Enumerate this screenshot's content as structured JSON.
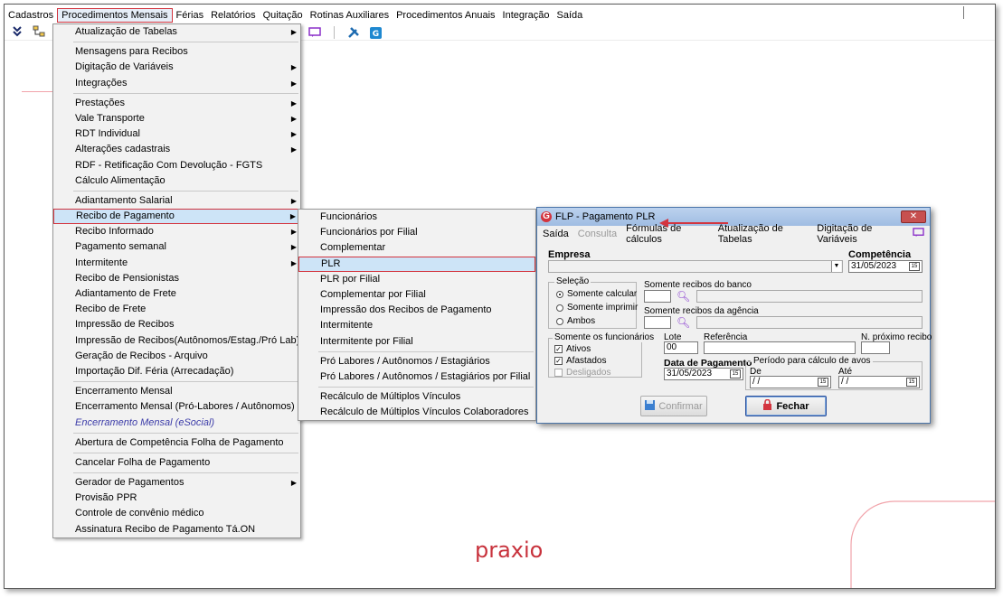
{
  "menubar": {
    "items": [
      "Cadastros",
      "Procedimentos Mensais",
      "Férias",
      "Relatórios",
      "Quitação",
      "Rotinas Auxiliares",
      "Procedimentos Anuais",
      "Integração",
      "Saída"
    ]
  },
  "main_menu": {
    "items": [
      {
        "label": "Atualização de Tabelas",
        "arrow": true
      },
      {
        "sep": true
      },
      {
        "label": "Mensagens para Recibos"
      },
      {
        "label": "Digitação de Variáveis",
        "arrow": true
      },
      {
        "label": "Integrações",
        "arrow": true
      },
      {
        "sep": true
      },
      {
        "label": "Prestações",
        "arrow": true
      },
      {
        "label": "Vale Transporte",
        "arrow": true
      },
      {
        "label": "RDT Individual",
        "arrow": true
      },
      {
        "label": "Alterações cadastrais",
        "arrow": true
      },
      {
        "label": "RDF - Retificação Com Devolução - FGTS"
      },
      {
        "label": "Cálculo Alimentação"
      },
      {
        "sep": true
      },
      {
        "label": "Adiantamento Salarial",
        "arrow": true
      },
      {
        "label": "Recibo de Pagamento",
        "arrow": true,
        "highlight": true
      },
      {
        "label": "Recibo Informado",
        "arrow": true
      },
      {
        "label": "Pagamento semanal",
        "arrow": true
      },
      {
        "label": "Intermitente",
        "arrow": true
      },
      {
        "label": "Recibo de Pensionistas"
      },
      {
        "label": "Adiantamento de Frete"
      },
      {
        "label": "Recibo de Frete"
      },
      {
        "label": "Impressão de Recibos"
      },
      {
        "label": "Impressão de Recibos(Autônomos/Estag./Pró Lab)"
      },
      {
        "label": "Geração de Recibos - Arquivo"
      },
      {
        "label": "Importação Dif. Féria (Arrecadação)"
      },
      {
        "sep": true
      },
      {
        "label": "Encerramento Mensal"
      },
      {
        "label": "Encerramento Mensal (Pró-Labores / Autônomos)"
      },
      {
        "label": "Encerramento Mensal (eSocial)",
        "blue": true
      },
      {
        "sep": true
      },
      {
        "label": "Abertura de Competência Folha de Pagamento"
      },
      {
        "sep": true
      },
      {
        "label": "Cancelar Folha de Pagamento"
      },
      {
        "sep": true
      },
      {
        "label": "Gerador de Pagamentos",
        "arrow": true
      },
      {
        "label": "Provisão PPR"
      },
      {
        "label": "Controle de convênio médico"
      },
      {
        "label": "Assinatura Recibo de Pagamento Tá.ON"
      }
    ]
  },
  "sub_menu": {
    "items": [
      {
        "label": "Funcionários"
      },
      {
        "label": "Funcionários por Filial"
      },
      {
        "label": "Complementar"
      },
      {
        "label": "PLR",
        "highlight": true
      },
      {
        "label": "PLR por Filial"
      },
      {
        "label": "Complementar por Filial"
      },
      {
        "label": "Impressão dos Recibos de Pagamento"
      },
      {
        "label": "Intermitente"
      },
      {
        "label": "Intermitente por Filial"
      },
      {
        "sep": true
      },
      {
        "label": "Pró Labores / Autônomos / Estagiários"
      },
      {
        "label": "Pró Labores / Autônomos / Estagiários por Filial"
      },
      {
        "sep": true
      },
      {
        "label": "Recálculo de Múltiplos Vínculos"
      },
      {
        "label": "Recálculo de Múltiplos Vínculos Colaboradores"
      }
    ]
  },
  "dialog": {
    "title": "FLP - Pagamento PLR",
    "menu": [
      {
        "label": "Saída",
        "disabled": false
      },
      {
        "label": "Consulta",
        "disabled": true
      },
      {
        "label": "Fórmulas de cálculos",
        "disabled": false
      },
      {
        "label": "Atualização de Tabelas",
        "disabled": false
      },
      {
        "label": "Digitação de Variáveis",
        "disabled": false
      }
    ],
    "empresa_label": "Empresa",
    "competencia_label": "Competência",
    "competencia_value": "31/05/2023",
    "selecao_label": "Seleção",
    "selecao_options": [
      "Somente calcular",
      "Somente imprimir",
      "Ambos"
    ],
    "banco_label": "Somente recibos do banco",
    "agencia_label": "Somente recibos da agência",
    "funcionarios_label": "Somente os funcionários",
    "funcionarios_options": [
      {
        "label": "Ativos",
        "checked": true,
        "disabled": false
      },
      {
        "label": "Afastados",
        "checked": true,
        "disabled": false
      },
      {
        "label": "Desligados",
        "checked": false,
        "disabled": true
      }
    ],
    "lote_label": "Lote",
    "lote_value": "00",
    "referencia_label": "Referência",
    "proximo_label": "N. próximo recibo",
    "data_pagamento_label": "Data de Pagamento",
    "data_pagamento_value": "31/05/2023",
    "periodo_label": "Período para cálculo de avos",
    "de_label": "De",
    "ate_label": "Até",
    "de_value": " / /",
    "ate_value": " / /",
    "confirmar_label": "Confirmar",
    "fechar_label": "Fechar",
    "close_glyph": "✕"
  },
  "logo_text": "praxio",
  "colors": {
    "accent": "#d3343e",
    "highlight": "#cde4f7",
    "dialog_title": "#bcd2ee"
  }
}
